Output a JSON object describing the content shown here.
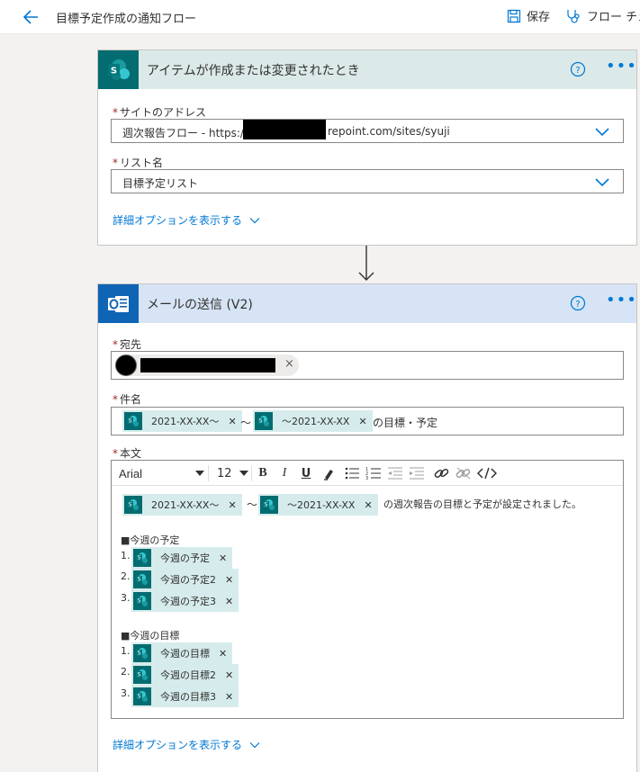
{
  "header": {
    "title": "目標予定作成の通知フロー",
    "save_label": "保存",
    "checker_label": "フロー チェッ"
  },
  "trigger": {
    "title": "アイテムが作成または変更されたとき",
    "site_label": "サイトのアドレス",
    "site_value_prefix": "週次報告フロー - https://",
    "site_value_suffix": "repoint.com/sites/syuji",
    "list_label": "リスト名",
    "list_value": "目標予定リスト",
    "advanced_label": "詳細オプションを表示する"
  },
  "action": {
    "title": "メールの送信 (V2)",
    "to_label": "宛先",
    "subject_label": "件名",
    "subject_tokens": [
      "2021-XX-XX～",
      "～2021-XX-XX"
    ],
    "subject_separator": "～",
    "subject_suffix": "の目標・予定",
    "body_label": "本文",
    "toolbar": {
      "font": "Arial",
      "size": "12"
    },
    "body_tokens": [
      "2021-XX-XX～",
      "～2021-XX-XX"
    ],
    "body_separator": "～",
    "body_sentence": "の週次報告の目標と予定が設定されました。",
    "plans_heading": "■今週の予定",
    "plans": [
      "今週の予定",
      "今週の予定2",
      "今週の予定3"
    ],
    "goals_heading": "■今週の目標",
    "goals": [
      "今週の目標",
      "今週の目標2",
      "今週の目標3"
    ],
    "list_numbers": [
      "1.",
      "2.",
      "3."
    ],
    "advanced_label": "詳細オプションを表示する"
  },
  "colors": {
    "accent": "#0078d4",
    "sharepoint": "#036c70",
    "trigger_header": "#dbe9e9",
    "action_header": "#d6e4f5",
    "token_bg": "#d6ecec"
  },
  "icons": {
    "back": "arrow-left-icon",
    "save": "save-icon",
    "checker": "stethoscope-icon",
    "sharepoint": "sharepoint-icon",
    "outlook": "outlook-icon",
    "help": "help-circle-icon",
    "more": "more-icon",
    "chevron": "chevron-down-icon",
    "remove": "close-icon"
  }
}
